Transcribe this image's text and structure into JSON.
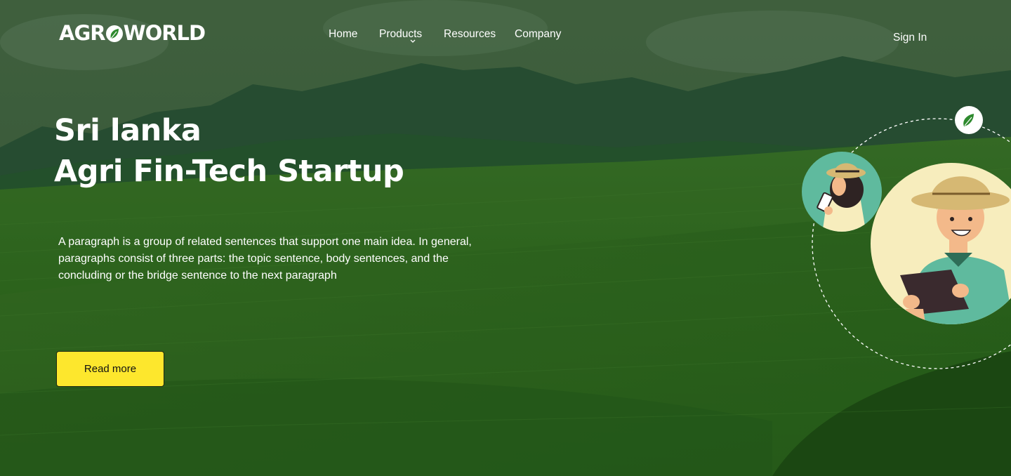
{
  "brand": {
    "logo_text_left": "AGR",
    "logo_text_right": "WORLD"
  },
  "nav": {
    "items": [
      {
        "label": "Home"
      },
      {
        "label": "Products"
      },
      {
        "label": "Resources"
      },
      {
        "label": "Company"
      }
    ],
    "sign_in": "Sign In"
  },
  "hero": {
    "title_line1": "Sri lanka",
    "title_line2": "Agri Fin-Tech Startup",
    "paragraph": "A paragraph is a group of related sentences that support one main idea. In general, paragraphs consist of three parts: the topic sentence, body sentences, and the concluding or the bridge sentence to the next paragraph",
    "cta_label": "Read more"
  },
  "colors": {
    "cta_background": "#fde72d",
    "field_green": "#2f6a20",
    "overlay": "#1f4a1f",
    "avatar_teal": "#5fba9e",
    "avatar_cream": "#f7edbd"
  },
  "icons": {
    "products_dropdown": "chevron-down-icon",
    "badge": "leaf-icon"
  }
}
